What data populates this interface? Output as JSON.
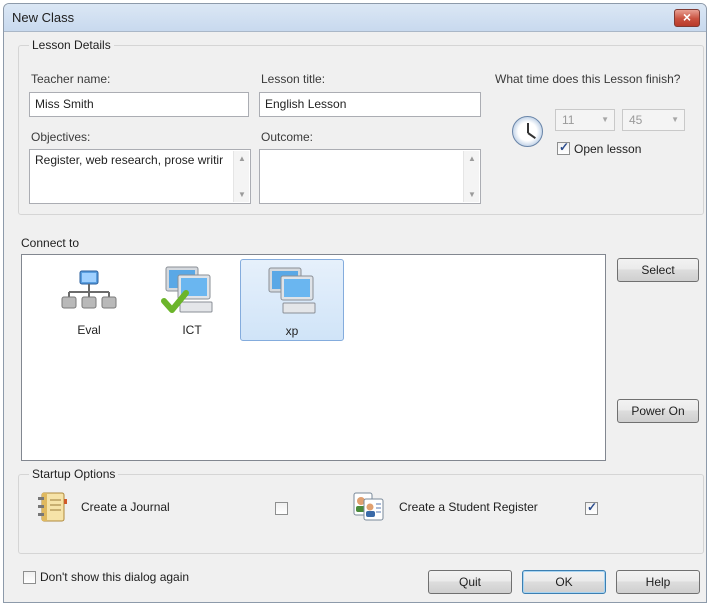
{
  "window": {
    "title": "New Class",
    "close_glyph": "×"
  },
  "lesson_details": {
    "group_label": "Lesson Details",
    "teacher_label": "Teacher name:",
    "teacher_value": "Miss Smith",
    "title_label": "Lesson title:",
    "title_value": "English Lesson",
    "objectives_label": "Objectives:",
    "objectives_value": "Register, web research, prose writir",
    "outcome_label": "Outcome:",
    "outcome_value": "",
    "finish_label": "What time does this Lesson finish?",
    "hour": "11",
    "minute": "45",
    "open_lesson_label": "Open lesson",
    "open_lesson_checked": true
  },
  "connect": {
    "label": "Connect to",
    "items": [
      {
        "label": "Eval",
        "icon": "network-icon"
      },
      {
        "label": "ICT",
        "icon": "computer-check-icon"
      },
      {
        "label": "xp",
        "icon": "computer-icon",
        "selected": true
      }
    ],
    "select_button": "Select",
    "power_on_button": "Power On"
  },
  "startup": {
    "label": "Startup Options",
    "journal_label": "Create a Journal",
    "journal_checked": false,
    "register_label": "Create a Student Register",
    "register_checked": true
  },
  "footer": {
    "dont_show_label": "Don't show this dialog again",
    "dont_show_checked": false,
    "quit_button": "Quit",
    "ok_button": "OK",
    "help_button": "Help"
  }
}
